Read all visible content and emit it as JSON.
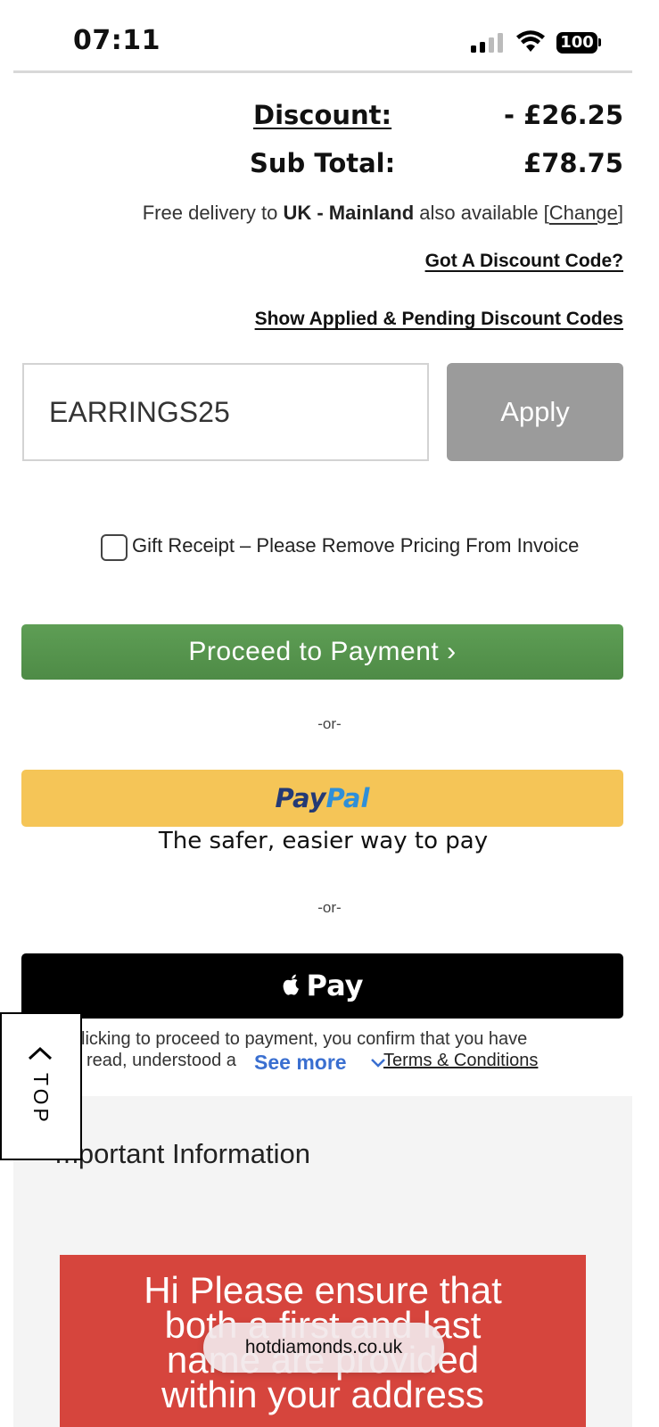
{
  "status_bar": {
    "time": "07:11",
    "battery": "100"
  },
  "totals": {
    "discount_label": "Discount:",
    "discount_value": "- £26.25",
    "subtotal_label": "Sub Total:",
    "subtotal_value": "£78.75"
  },
  "delivery": {
    "prefix": "Free delivery to ",
    "region": "UK - Mainland",
    "suffix": " also available [",
    "change_link": "Change",
    "close_bracket": "]"
  },
  "discount": {
    "got_code_link": "Got A Discount Code?",
    "show_codes_link": "Show Applied & Pending Discount Codes",
    "code_value": "EARRINGS25",
    "apply_label": "Apply"
  },
  "gift_receipt": {
    "label": "Gift Receipt – Please Remove Pricing From Invoice",
    "checked": false
  },
  "payment": {
    "proceed_label": "Proceed to Payment ›",
    "or_1": "-or-",
    "paypal_part1": "Pay",
    "paypal_part2": "Pal",
    "paypal_tagline": "The safer, easier way to pay",
    "or_2": "-or-",
    "applepay_label": "Pay"
  },
  "terms": {
    "line1": "licking to proceed to payment, you confirm that you have",
    "line2_prefix": "read, understood a",
    "line2_link": "Terms & Conditions",
    "see_more": "See more"
  },
  "info": {
    "heading": "mportant Information",
    "notice_line1": "Hi Please ensure that",
    "notice_line2": "both a first and last",
    "notice_line3": "name are provided",
    "notice_line4": "within your address"
  },
  "top_button": {
    "label": "TOP"
  },
  "browser": {
    "url": "hotdiamonds.co.uk"
  },
  "colors": {
    "proceed_green": "#5a9a50",
    "paypal_yellow": "#f5c557",
    "apply_grey": "#9b9b9b",
    "notice_red": "#d6453d",
    "see_more_blue": "#3a6fd0"
  }
}
